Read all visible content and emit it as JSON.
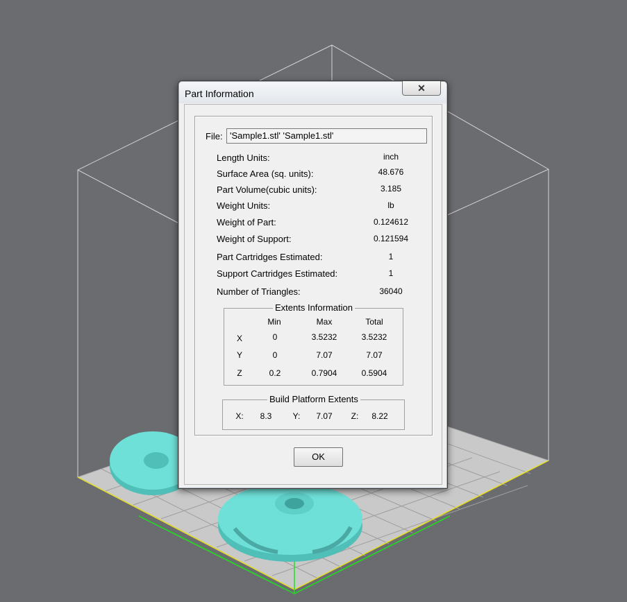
{
  "dialog": {
    "title": "Part Information",
    "close_glyph": "✕",
    "file_label": "File:",
    "file_value": "'Sample1.stl' 'Sample1.stl'",
    "properties": [
      {
        "label": "Length Units:",
        "value": "inch"
      },
      {
        "label": "Surface Area (sq. units):",
        "value": "48.676"
      },
      {
        "label": "Part Volume(cubic units):",
        "value": "3.185"
      },
      {
        "label": "Weight Units:",
        "value": "lb"
      },
      {
        "label": "Weight of Part:",
        "value": "0.124612"
      },
      {
        "label": "Weight of Support:",
        "value": "0.121594"
      },
      {
        "label": "Part Cartridges Estimated:",
        "value": "1"
      },
      {
        "label": "Support Cartridges Estimated:",
        "value": "1"
      },
      {
        "label": "Number of Triangles:",
        "value": "36040"
      }
    ],
    "extents": {
      "title": "Extents Information",
      "headers": [
        "Min",
        "Max",
        "Total"
      ],
      "rows": [
        {
          "axis": "X",
          "min": "0",
          "max": "3.5232",
          "total": "3.5232"
        },
        {
          "axis": "Y",
          "min": "0",
          "max": "7.07",
          "total": "7.07"
        },
        {
          "axis": "Z",
          "min": "0.2",
          "max": "0.7904",
          "total": "0.5904"
        }
      ]
    },
    "build_platform": {
      "title": "Build Platform Extents",
      "x_label": "X:",
      "x_value": "8.3",
      "y_label": "Y:",
      "y_value": "7.07",
      "z_label": "Z:",
      "z_value": "8.22"
    },
    "ok_label": "OK"
  },
  "colors": {
    "background": "#6b6c70",
    "platform": "#c8c8c8",
    "part": "#6ee0d8",
    "x_axis": "#e8e020",
    "y_axis": "#20e020"
  }
}
